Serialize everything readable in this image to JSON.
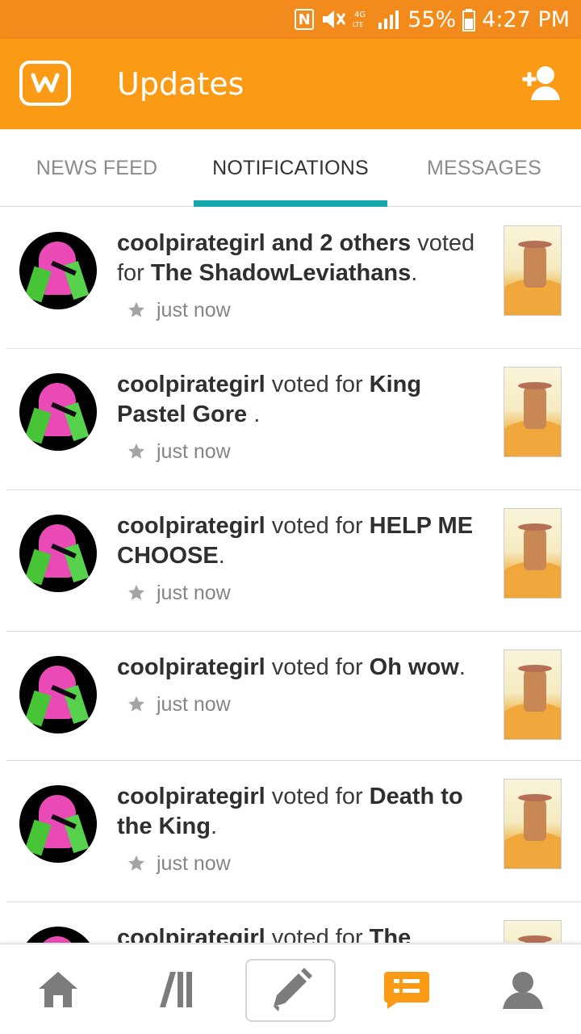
{
  "status_bar": {
    "battery_percent": "55%",
    "time": "4:27 PM",
    "icons": [
      "nfc-icon",
      "mute-icon",
      "lte-icon",
      "signal-icon",
      "battery-icon"
    ]
  },
  "header": {
    "title": "Updates",
    "logo": "wattpad-w-logo-icon",
    "right_action_icon": "add-user-icon"
  },
  "tabs": [
    {
      "label": "NEWS FEED",
      "active": false
    },
    {
      "label": "NOTIFICATIONS",
      "active": true
    },
    {
      "label": "MESSAGES",
      "active": false
    }
  ],
  "notifications": [
    {
      "user": "coolpirategirl and 2 others",
      "action": " voted for ",
      "story": "The ShadowLeviathans",
      "end": ".",
      "time": "just now"
    },
    {
      "user": "coolpirategirl",
      "action": " voted for ",
      "story": "King Pastel Gore ",
      "end": ".",
      "time": "just now"
    },
    {
      "user": "coolpirategirl",
      "action": " voted for ",
      "story": "HELP ME CHOOSE",
      "end": ".",
      "time": "just now"
    },
    {
      "user": "coolpirategirl",
      "action": " voted for ",
      "story": "Oh wow",
      "end": ".",
      "time": "just now"
    },
    {
      "user": "coolpirategirl",
      "action": " voted for ",
      "story": "Death to the King",
      "end": ".",
      "time": "just now"
    },
    {
      "user": "coolpirategirl",
      "action": " voted for ",
      "story": "The",
      "end": "",
      "time": ""
    }
  ],
  "bottom_nav": [
    {
      "name": "home-icon"
    },
    {
      "name": "library-icon"
    },
    {
      "name": "write-icon"
    },
    {
      "name": "updates-icon",
      "active": true
    },
    {
      "name": "profile-icon"
    }
  ],
  "colors": {
    "status_orange": "#f38a1c",
    "brand_orange": "#fa9a15",
    "tab_accent": "#14a8ad",
    "text_dark": "#333333",
    "text_gray": "#858585"
  }
}
